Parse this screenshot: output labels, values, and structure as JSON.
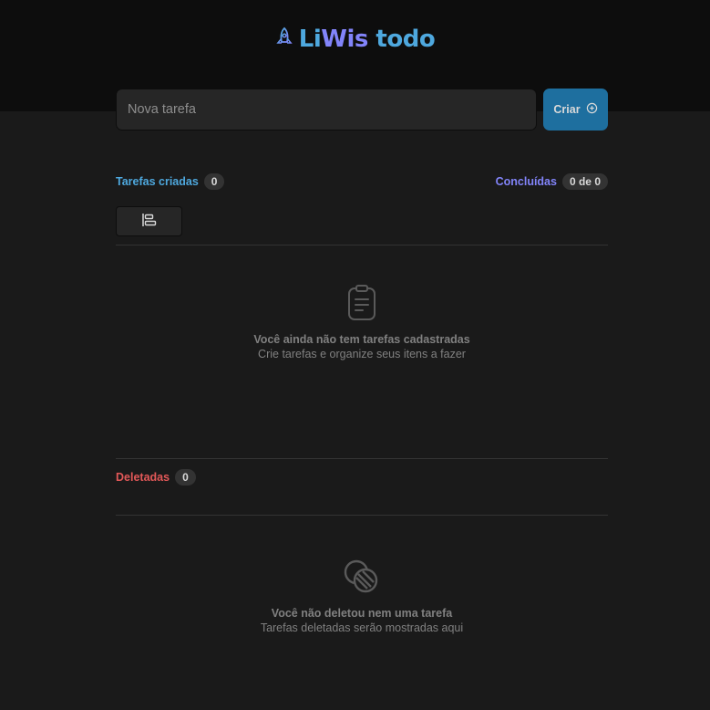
{
  "header": {
    "logo_icon": "rocket-icon",
    "title_part1": "Li",
    "title_part2": "Wis",
    "title_part3": "todo",
    "colors": {
      "blue": "#4ea8de",
      "purple": "#8284fa"
    }
  },
  "form": {
    "placeholder": "Nova tarefa",
    "create_label": "Criar",
    "create_icon": "plus-circle-icon"
  },
  "counters": {
    "created_label": "Tarefas criadas",
    "created_count": "0",
    "completed_label": "Concluídas",
    "completed_count": "0 de 0",
    "deleted_label": "Deletadas",
    "deleted_count": "0"
  },
  "toolbar": {
    "sort_icon": "align-left-icon"
  },
  "empty_tasks": {
    "icon": "clipboard-icon",
    "title": "Você ainda não tem tarefas cadastradas",
    "subtitle": "Crie tarefas e organize seus itens a fazer"
  },
  "empty_deleted": {
    "icon": "trash-coins-icon",
    "title": "Você não deletou nem uma tarefa",
    "subtitle": "Tarefas deletadas serão mostradas aqui"
  }
}
